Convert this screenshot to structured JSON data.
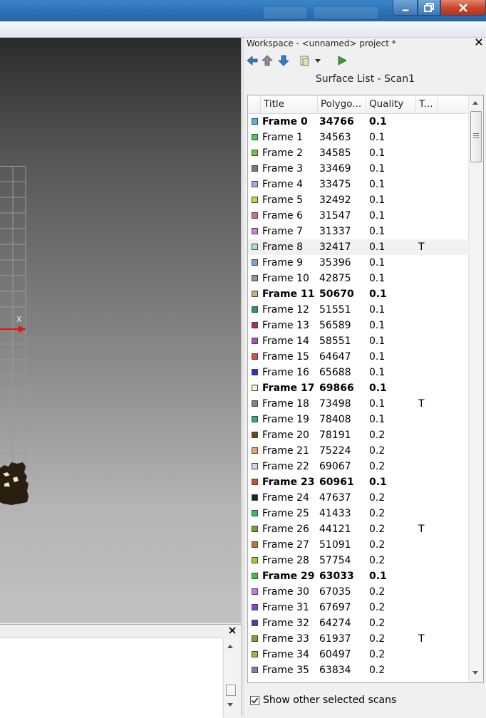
{
  "window": {
    "controls": {
      "minimize_icon": "minimize-icon",
      "maximize_icon": "restore-icon",
      "close_icon": "close-icon"
    }
  },
  "viewport": {
    "axis_label": "X"
  },
  "workspace": {
    "title": "Workspace - <unnamed> project *",
    "surface_list_title": "Surface List - Scan1",
    "columns": [
      "Title",
      "Polygo...",
      "Quality",
      "T..."
    ],
    "show_other_label": "Show other selected scans",
    "show_other_checked": true,
    "rows": [
      {
        "title": "Frame 0",
        "polygons": "34766",
        "quality": "0.1",
        "t": "",
        "color": "#4db8e0",
        "bold": true
      },
      {
        "title": "Frame 1",
        "polygons": "34563",
        "quality": "0.1",
        "t": "",
        "color": "#44cc55",
        "bold": false
      },
      {
        "title": "Frame 2",
        "polygons": "34585",
        "quality": "0.1",
        "t": "",
        "color": "#6bc93a",
        "bold": false
      },
      {
        "title": "Frame 3",
        "polygons": "33469",
        "quality": "0.1",
        "t": "",
        "color": "#8a7a62",
        "bold": false
      },
      {
        "title": "Frame 4",
        "polygons": "33475",
        "quality": "0.1",
        "t": "",
        "color": "#a6a6ee",
        "bold": false
      },
      {
        "title": "Frame 5",
        "polygons": "32492",
        "quality": "0.1",
        "t": "",
        "color": "#b4e033",
        "bold": false
      },
      {
        "title": "Frame 6",
        "polygons": "31547",
        "quality": "0.1",
        "t": "",
        "color": "#d86a9a",
        "bold": false
      },
      {
        "title": "Frame 7",
        "polygons": "31337",
        "quality": "0.1",
        "t": "",
        "color": "#d37ed8",
        "bold": false
      },
      {
        "title": "Frame 8",
        "polygons": "32417",
        "quality": "0.1",
        "t": "T",
        "color": "#aee8b8",
        "bold": false,
        "highlight": true
      },
      {
        "title": "Frame 9",
        "polygons": "35396",
        "quality": "0.1",
        "t": "",
        "color": "#7f9fe6",
        "bold": false
      },
      {
        "title": "Frame 10",
        "polygons": "42875",
        "quality": "0.1",
        "t": "",
        "color": "#8a9a92",
        "bold": false
      },
      {
        "title": "Frame 11",
        "polygons": "50670",
        "quality": "0.1",
        "t": "",
        "color": "#cbb07c",
        "bold": true
      },
      {
        "title": "Frame 12",
        "polygons": "51551",
        "quality": "0.1",
        "t": "",
        "color": "#2a9a5a",
        "bold": false
      },
      {
        "title": "Frame 13",
        "polygons": "56589",
        "quality": "0.1",
        "t": "",
        "color": "#a8324a",
        "bold": false
      },
      {
        "title": "Frame 14",
        "polygons": "58551",
        "quality": "0.1",
        "t": "",
        "color": "#b24ad0",
        "bold": false
      },
      {
        "title": "Frame 15",
        "polygons": "64647",
        "quality": "0.1",
        "t": "",
        "color": "#e04a3a",
        "bold": false
      },
      {
        "title": "Frame 16",
        "polygons": "65688",
        "quality": "0.1",
        "t": "",
        "color": "#2a32c8",
        "bold": false
      },
      {
        "title": "Frame 17",
        "polygons": "69866",
        "quality": "0.1",
        "t": "",
        "color": "#f6f0cc",
        "bold": true
      },
      {
        "title": "Frame 18",
        "polygons": "73498",
        "quality": "0.1",
        "t": "T",
        "color": "#8e7a8a",
        "bold": false
      },
      {
        "title": "Frame 19",
        "polygons": "78408",
        "quality": "0.1",
        "t": "",
        "color": "#2ab07a",
        "bold": false
      },
      {
        "title": "Frame 20",
        "polygons": "78191",
        "quality": "0.2",
        "t": "",
        "color": "#6a4a1a",
        "bold": false
      },
      {
        "title": "Frame 21",
        "polygons": "75224",
        "quality": "0.2",
        "t": "",
        "color": "#f0a06a",
        "bold": false
      },
      {
        "title": "Frame 22",
        "polygons": "69067",
        "quality": "0.2",
        "t": "",
        "color": "#dcd0ec",
        "bold": false
      },
      {
        "title": "Frame 23",
        "polygons": "60961",
        "quality": "0.1",
        "t": "",
        "color": "#d44a2a",
        "bold": true
      },
      {
        "title": "Frame 24",
        "polygons": "47637",
        "quality": "0.2",
        "t": "",
        "color": "#1a2a1a",
        "bold": false
      },
      {
        "title": "Frame 25",
        "polygons": "41433",
        "quality": "0.2",
        "t": "",
        "color": "#2ac84a",
        "bold": false
      },
      {
        "title": "Frame 26",
        "polygons": "44121",
        "quality": "0.2",
        "t": "T",
        "color": "#7aa030",
        "bold": false
      },
      {
        "title": "Frame 27",
        "polygons": "51091",
        "quality": "0.2",
        "t": "",
        "color": "#d86a2a",
        "bold": false
      },
      {
        "title": "Frame 28",
        "polygons": "57754",
        "quality": "0.2",
        "t": "",
        "color": "#a8cc2a",
        "bold": false
      },
      {
        "title": "Frame 29",
        "polygons": "63033",
        "quality": "0.1",
        "t": "",
        "color": "#3ac83a",
        "bold": true
      },
      {
        "title": "Frame 30",
        "polygons": "67035",
        "quality": "0.2",
        "t": "",
        "color": "#c87ae6",
        "bold": false
      },
      {
        "title": "Frame 31",
        "polygons": "67697",
        "quality": "0.2",
        "t": "",
        "color": "#8a3ae0",
        "bold": false
      },
      {
        "title": "Frame 32",
        "polygons": "64274",
        "quality": "0.2",
        "t": "",
        "color": "#5a3aa8",
        "bold": false
      },
      {
        "title": "Frame 33",
        "polygons": "61937",
        "quality": "0.2",
        "t": "T",
        "color": "#8aa02a",
        "bold": false
      },
      {
        "title": "Frame 34",
        "polygons": "60497",
        "quality": "0.2",
        "t": "",
        "color": "#9cb83a",
        "bold": false
      },
      {
        "title": "Frame 35",
        "polygons": "63834",
        "quality": "0.2",
        "t": "",
        "color": "#7a8a9a",
        "bold": false
      }
    ]
  }
}
